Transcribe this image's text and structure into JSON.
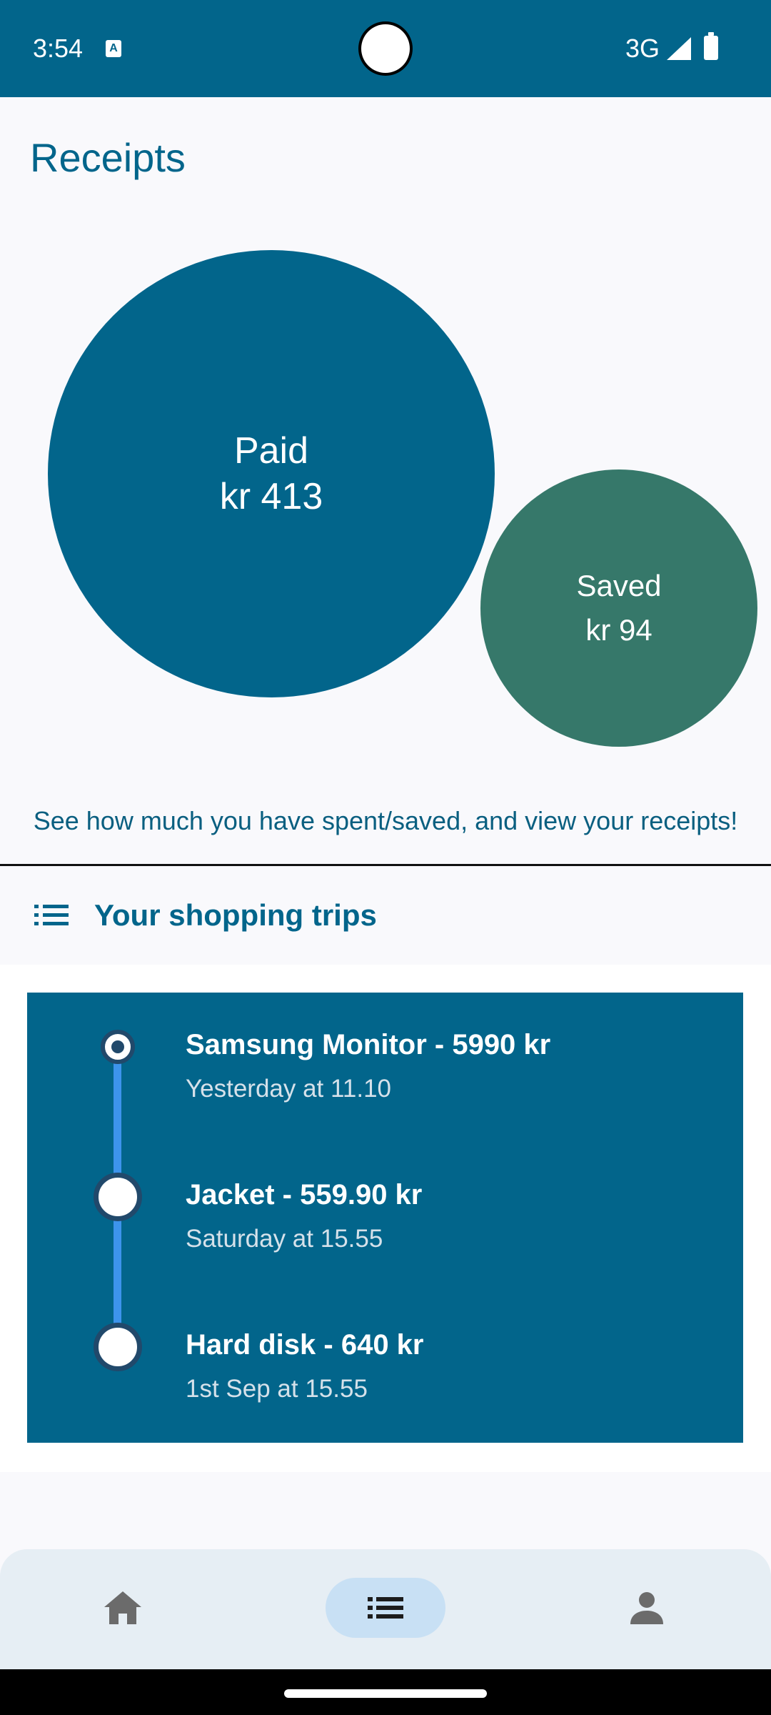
{
  "status_bar": {
    "time": "3:54",
    "app_icon": "accessibility-a-icon",
    "network": "3G",
    "signal_icon": "signal-icon",
    "battery_icon": "battery-icon",
    "color": "#02658b"
  },
  "page": {
    "title": "Receipts"
  },
  "summary": {
    "paid_label": "Paid",
    "paid_value": "kr 413",
    "saved_label": "Saved",
    "saved_value": "kr 94",
    "paid_color": "#02658b",
    "saved_color": "#36786a",
    "caption": "See how much you have spent/saved, and view your receipts!"
  },
  "trips_section": {
    "icon": "list-icon",
    "title": "Your shopping trips"
  },
  "trips": [
    {
      "title": "Samsung Monitor - 5990 kr",
      "time": "Yesterday at 11.10",
      "active": true
    },
    {
      "title": "Jacket - 559.90 kr",
      "time": "Saturday at 15.55",
      "active": false
    },
    {
      "title": "Hard disk - 640 kr",
      "time": "1st Sep at 15.55",
      "active": false
    }
  ],
  "bottom_nav": {
    "items": [
      {
        "icon": "home-icon",
        "selected": false
      },
      {
        "icon": "list-icon",
        "selected": true
      },
      {
        "icon": "person-icon",
        "selected": false
      }
    ]
  }
}
